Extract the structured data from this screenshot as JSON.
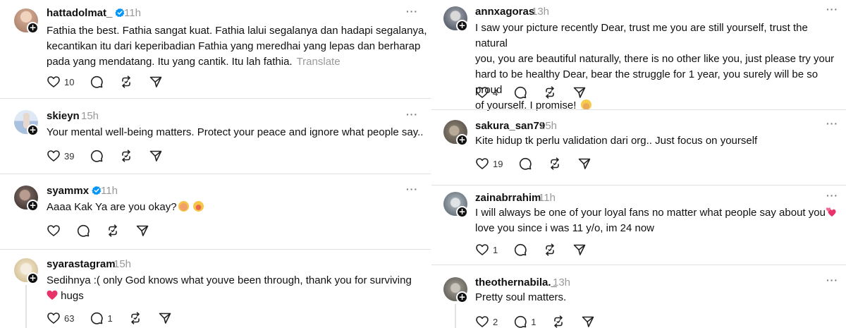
{
  "left_column": {
    "posts": [
      {
        "username": "hattadolmat_",
        "verified": true,
        "time": "11h",
        "lines": [
          "Fathia the best. Fathia sangat kuat. Fathia lalui segalanya dan hadapi segalanya,",
          "kecantikan itu dari keperibadian Fathia yang meredhai yang lepas dan berharap",
          "pada yang mendatang. Itu yang cantik. Itu lah fathia."
        ],
        "translate_label": "Translate",
        "likes": "10",
        "replies": "",
        "avatar_color": "#c9a089"
      },
      {
        "username": "skieyn",
        "verified": false,
        "time": "15h",
        "lines": [
          "Your mental well-being matters. Protect your peace and ignore what people say.."
        ],
        "likes": "39",
        "replies": "",
        "avatar_color": "#a9c1de"
      },
      {
        "username": "syammx",
        "verified": true,
        "time": "11h",
        "lines": [
          "Aaaa Kak Ya are you okay?"
        ],
        "likes": "",
        "replies": "",
        "avatar_color": "#6b5a55"
      },
      {
        "username": "syarastagram",
        "verified": false,
        "time": "15h",
        "lines": [
          "Sedihnya :( only God knows what youve been through, thank you for surviving",
          "hugs"
        ],
        "likes": "63",
        "replies": "1",
        "avatar_color": "#e8d9b8"
      }
    ]
  },
  "right_column": {
    "posts": [
      {
        "username": "annxagoras",
        "verified": false,
        "time": "13h",
        "lines": [
          "I saw your picture recently Dear, trust me you are still yourself, trust the natural",
          "you, you are beautiful naturally, there is no other like you, just please try your",
          "hard to be healthy Dear, bear the struggle for 1 year, you surely will be so proud",
          "of yourself. I promise!"
        ],
        "likes": "4",
        "replies": "",
        "avatar_color": "#8a8f99"
      },
      {
        "username": "sakura_san79",
        "verified": false,
        "time": "15h",
        "lines": [
          "Kite hidup tk perlu validation dari org.. Just focus on yourself"
        ],
        "likes": "19",
        "replies": "",
        "avatar_color": "#7d7468"
      },
      {
        "username": "zainabrrahim",
        "verified": false,
        "time": "11h",
        "lines": [
          "I will always be one of your loyal fans no matter what people say about you",
          "love you since i was 11 y/o, im 24 now"
        ],
        "likes": "1",
        "replies": "",
        "avatar_color": "#9aa3ab"
      },
      {
        "username": "theothernabila._",
        "verified": false,
        "time": "13h",
        "lines": [
          "Pretty soul matters."
        ],
        "likes": "2",
        "replies": "1",
        "avatar_color": "#8d8a82"
      }
    ]
  },
  "more_glyph": "···",
  "plus_glyph": "+",
  "colors": {
    "verified": "#0095f6",
    "heart_emoji": "#e8336a",
    "text": "#101010",
    "muted": "#999999",
    "separator": "#e0e0e0"
  },
  "icons": [
    "like-icon",
    "reply-icon",
    "repost-icon",
    "share-icon",
    "verified-icon",
    "more-icon"
  ]
}
